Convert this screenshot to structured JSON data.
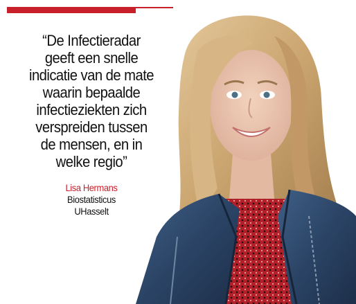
{
  "accent_color": "#c7202a",
  "quote": {
    "lines": [
      "“De Infectieradar",
      "geeft een snelle",
      "indicatie van de mate",
      "waarin bepaalde",
      "infectieziekten zich",
      "verspreiden tussen",
      "de mensen, en in",
      "welke regio”"
    ]
  },
  "credit": {
    "name": "Lisa Hermans",
    "role": "Biostatisticus",
    "organization": "UHasselt"
  }
}
